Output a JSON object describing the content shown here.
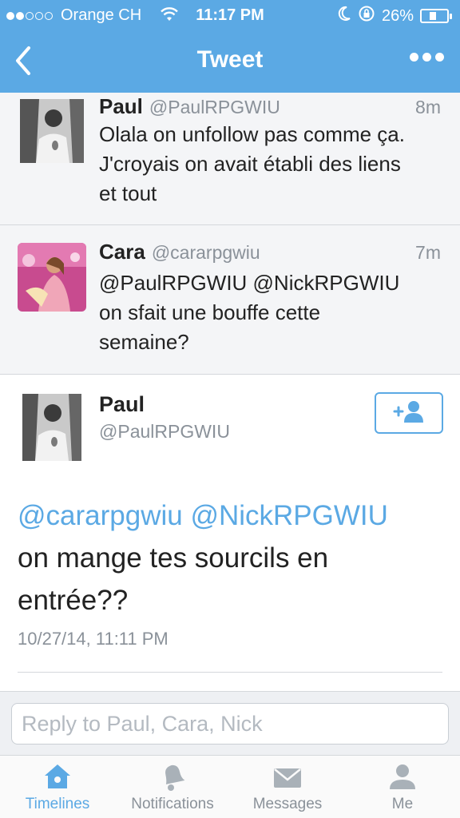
{
  "status_bar": {
    "carrier": "Orange CH",
    "time": "11:17 PM",
    "battery": "26%",
    "battery_level": 0.26
  },
  "nav": {
    "title": "Tweet",
    "back_icon": "chevron-left-icon",
    "more_icon": "more-dots-icon"
  },
  "replies": [
    {
      "name": "Paul",
      "handle": "@PaulRPGWIU",
      "time": "8m",
      "text_lines": [
        "Olala on unfollow pas comme ça.",
        "J'croyais on avait établi des liens",
        "et tout"
      ]
    },
    {
      "name": "Cara",
      "handle": "@cararpgwiu",
      "time": "7m",
      "text_lines": [
        "@PaulRPGWIU @NickRPGWIU",
        "on sfait une bouffe cette",
        "semaine?"
      ]
    }
  ],
  "main_tweet": {
    "name": "Paul",
    "handle": "@PaulRPGWIU",
    "mention_1": "@cararpgwiu",
    "mention_2": "@NickRPGWIU",
    "line_2": "on mange tes sourcils en",
    "line_3": "entrée??",
    "date": "10/27/14, 11:11 PM",
    "follow_icon": "add-user-icon"
  },
  "reply_box": {
    "placeholder": "Reply to Paul, Cara, Nick"
  },
  "tabs": [
    {
      "label": "Timelines",
      "icon": "home-icon",
      "active": true
    },
    {
      "label": "Notifications",
      "icon": "bell-icon",
      "active": false
    },
    {
      "label": "Messages",
      "icon": "envelope-icon",
      "active": false
    },
    {
      "label": "Me",
      "icon": "person-icon",
      "active": false
    }
  ],
  "colors": {
    "accent": "#5ba9e4",
    "muted": "#8a9199",
    "reply_bg": "#f4f5f7"
  }
}
